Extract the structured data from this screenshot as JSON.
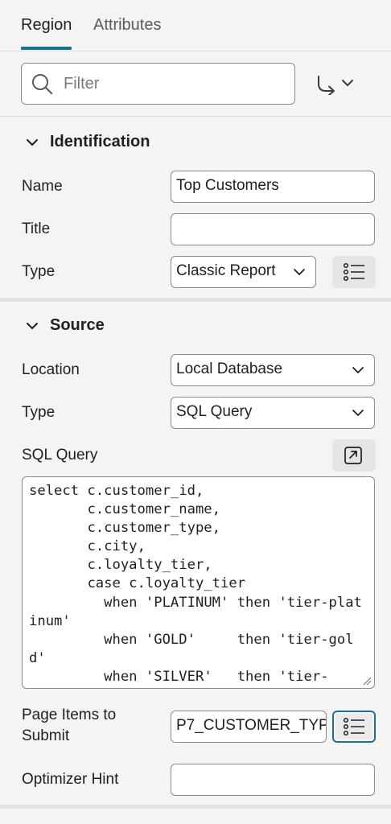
{
  "tabs": [
    {
      "label": "Region",
      "active": true
    },
    {
      "label": "Attributes",
      "active": false
    }
  ],
  "filter": {
    "placeholder": "Filter",
    "value": ""
  },
  "sections": {
    "identification": {
      "title": "Identification",
      "name_label": "Name",
      "name_value": "Top Customers",
      "title_label": "Title",
      "title_value": "",
      "type_label": "Type",
      "type_value": "Classic Report"
    },
    "source": {
      "title": "Source",
      "location_label": "Location",
      "location_value": "Local Database",
      "type_label": "Type",
      "type_value": "SQL Query",
      "sql_label": "SQL Query",
      "sql_value": "select c.customer_id,\n       c.customer_name,\n       c.customer_type,\n       c.city,\n       c.loyalty_tier,\n       case c.loyalty_tier\n         when 'PLATINUM' then 'tier-platinum'\n         when 'GOLD'     then 'tier-gold'\n         when 'SILVER'   then 'tier-",
      "page_items_label": "Page Items to Submit",
      "page_items_value": "P7_CUSTOMER_TYP",
      "optimizer_label": "Optimizer Hint",
      "optimizer_value": ""
    }
  },
  "colors": {
    "accent": "#1c6f8e",
    "background": "#f4f4f3"
  }
}
